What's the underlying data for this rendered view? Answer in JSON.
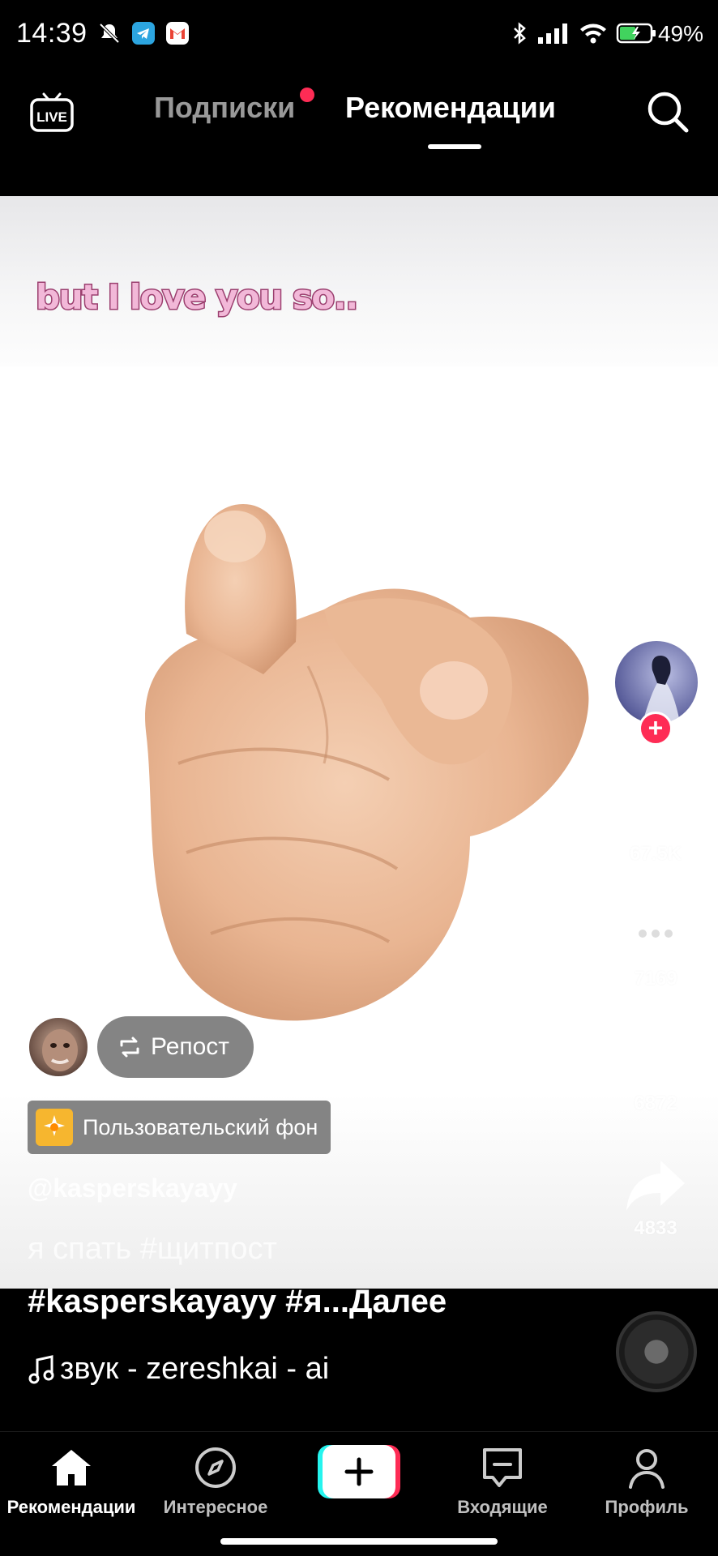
{
  "status_bar": {
    "time": "14:39",
    "battery": "49%",
    "icons": [
      "mute-icon",
      "telegram-icon",
      "gmail-icon",
      "bluetooth-icon",
      "signal-icon",
      "wifi-icon",
      "battery-icon"
    ]
  },
  "top_nav": {
    "live_label": "LIVE",
    "tabs": [
      {
        "label": "Подписки",
        "active": false,
        "has_dot": true
      },
      {
        "label": "Рекомендации",
        "active": true
      }
    ]
  },
  "video": {
    "overlay_text": "but I love you so..",
    "likes": "67.5K",
    "comments": "7169",
    "saves": "6872",
    "shares": "4833",
    "repost_label": "Репост",
    "background_chip": "Пользовательский фон",
    "username": "@kasperskayayy",
    "description_line1": "я спать #щитпост",
    "description_line2": "#kasperskayayy #я...Далее",
    "music": "звук - zereshkai - ai"
  },
  "bottom_nav": {
    "items": [
      {
        "label": "Рекомендации",
        "icon": "home-icon",
        "active": true
      },
      {
        "label": "Интересное",
        "icon": "compass-icon",
        "active": false
      },
      {
        "label": "",
        "icon": "create-icon",
        "active": false
      },
      {
        "label": "Входящие",
        "icon": "inbox-icon",
        "active": false
      },
      {
        "label": "Профиль",
        "icon": "profile-icon",
        "active": false
      }
    ]
  },
  "colors": {
    "accent_red": "#fe2c55",
    "create_cyan": "#25f4ee",
    "overlay_pink": "#f2b8d8"
  }
}
